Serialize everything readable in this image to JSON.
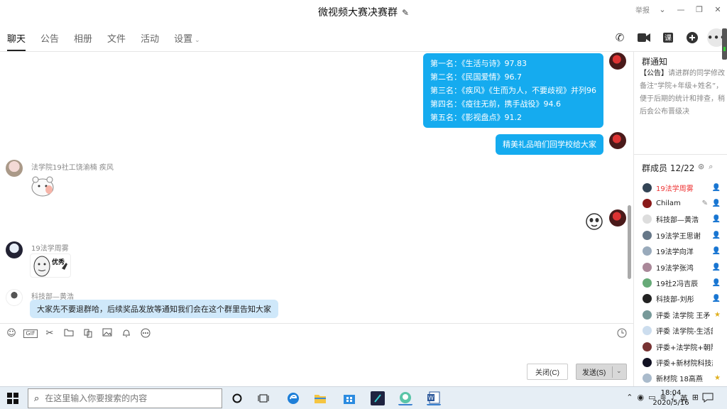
{
  "window": {
    "title": "微视频大赛决赛群",
    "report_label": "举报",
    "minimize": "—",
    "restore": "❐",
    "close": "✕"
  },
  "tabs": [
    {
      "label": "聊天",
      "active": true
    },
    {
      "label": "公告"
    },
    {
      "label": "相册"
    },
    {
      "label": "文件"
    },
    {
      "label": "活动"
    },
    {
      "label": "设置"
    }
  ],
  "toolbar_icons": [
    "phone-icon",
    "video-icon",
    "class-icon",
    "add-icon",
    "more-icon"
  ],
  "messages": {
    "ranking": [
      "第一名：《生活与诗》97.83",
      "第二名：《民国爱情》96.7",
      "第三名：《疾风》《生而为人，不要歧视》并列96",
      "第四名：《疫往无前，携手战役》94.6",
      "第五名：《影视盘点》91.2"
    ],
    "gift": "精美礼品咱们回学校给大家",
    "sender1": "法学院19社工饶渝楠 疾风",
    "sender2": "19法学周雾",
    "sender3": "科技部—黄浩",
    "sticker2_text": "优秀",
    "last": "大家先不要退群哈，后续奖品发放等通知我们会在这个群里告知大家"
  },
  "input": {
    "close_label": "关闭(C)",
    "send_label": "发送(S)"
  },
  "notice": {
    "title": "群通知",
    "tag": "【公告】",
    "text": "请进群的同学修改备注“学院+年级+姓名”，便于后期的统计和排查，稍后会公布晋级决"
  },
  "members": {
    "title": "群成员 12/22",
    "list": [
      {
        "name": "19法学周雾",
        "red": true,
        "badge": "owner"
      },
      {
        "name": "Chilam",
        "badge": "owner",
        "pen": true
      },
      {
        "name": "科技部—黄浩",
        "badge": "star"
      },
      {
        "name": "19法学王思谢",
        "badge": "star"
      },
      {
        "name": "19法学向洋",
        "badge": "star"
      },
      {
        "name": "19法学张鸿",
        "badge": "star"
      },
      {
        "name": "19社2冯吉辰",
        "badge": "star"
      },
      {
        "name": "科技部-刘彤",
        "badge": "star"
      },
      {
        "name": "评委 法学院 王矛",
        "badge": "gold"
      },
      {
        "name": "评委 法学院-生活部",
        "badge": ""
      },
      {
        "name": "评委+法学院+朝阳社",
        "badge": ""
      },
      {
        "name": "评委+新材院科技部刘",
        "badge": ""
      },
      {
        "name": "新材院 18高燕",
        "badge": "gold"
      }
    ]
  },
  "taskbar": {
    "search_placeholder": "在这里输入你要搜索的内容",
    "ime": "英",
    "time": "18:04",
    "date": "2020/5/16"
  }
}
